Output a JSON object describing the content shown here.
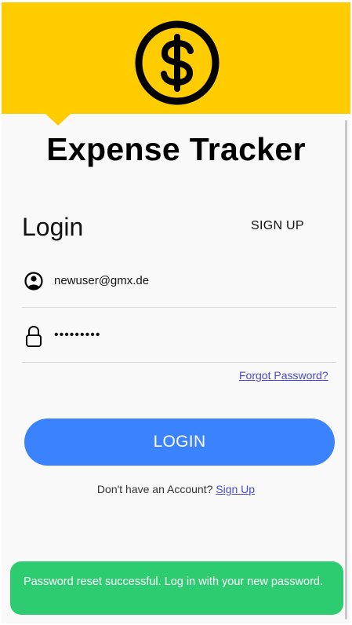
{
  "app": {
    "title": "Expense Tracker",
    "logo_icon": "dollar-coin-icon"
  },
  "colors": {
    "header": "#ffcc00",
    "primary": "#3b82ff",
    "link": "#4a4ad6",
    "toast": "#2ecc71"
  },
  "auth": {
    "login_heading": "Login",
    "signup_tab": "SIGN UP",
    "email_value": "newuser@gmx.de",
    "email_icon": "user-circle-icon",
    "password_value": "•••••••••",
    "password_icon": "lock-icon",
    "forgot_password": "Forgot Password?",
    "login_button": "LOGIN",
    "no_account_text": "Don't have an Account?",
    "signup_link": "Sign Up"
  },
  "toast": {
    "message": "Password reset successful. Log in with your new password."
  }
}
